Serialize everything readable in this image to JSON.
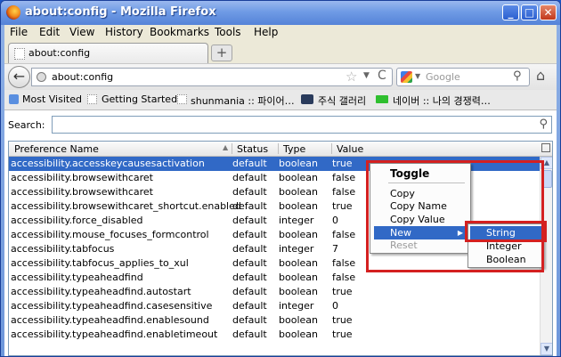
{
  "window": {
    "title": "about:config - Mozilla Firefox",
    "minimize": "_",
    "maximize": "□",
    "close": "✕"
  },
  "menubar": [
    {
      "label": "File"
    },
    {
      "label": "Edit"
    },
    {
      "label": "View"
    },
    {
      "label": "History"
    },
    {
      "label": "Bookmarks"
    },
    {
      "label": "Tools"
    },
    {
      "label": "Help"
    }
  ],
  "tab": {
    "label": "about:config",
    "new_tab": "+"
  },
  "navbar": {
    "url": "about:config",
    "search_placeholder": "Google",
    "back_icon": "←",
    "star_icon": "☆",
    "reload_icon": "C",
    "home_icon": "⌂"
  },
  "bookmarks": [
    {
      "label": "Most Visited"
    },
    {
      "label": "Getting Started"
    },
    {
      "label": "shunmania :: 파이어…"
    },
    {
      "label": "주식 갤러리"
    },
    {
      "label": "네이버 :: 나의 경쟁력…"
    }
  ],
  "search_label": "Search:",
  "columns": {
    "name": "Preference Name",
    "status": "Status",
    "type": "Type",
    "value": "Value"
  },
  "rows": [
    {
      "name": "accessibility.accesskeycausesactivation",
      "status": "default",
      "type": "boolean",
      "value": "true"
    },
    {
      "name": "accessibility.browsewithcaret",
      "status": "default",
      "type": "boolean",
      "value": "false"
    },
    {
      "name": "accessibility.browsewithcaret",
      "status": "default",
      "type": "boolean",
      "value": "false"
    },
    {
      "name": "accessibility.browsewithcaret_shortcut.enabled",
      "status": "default",
      "type": "boolean",
      "value": "true"
    },
    {
      "name": "accessibility.force_disabled",
      "status": "default",
      "type": "integer",
      "value": "0"
    },
    {
      "name": "accessibility.mouse_focuses_formcontrol",
      "status": "default",
      "type": "boolean",
      "value": "false"
    },
    {
      "name": "accessibility.tabfocus",
      "status": "default",
      "type": "integer",
      "value": "7"
    },
    {
      "name": "accessibility.tabfocus_applies_to_xul",
      "status": "default",
      "type": "boolean",
      "value": "false"
    },
    {
      "name": "accessibility.typeaheadfind",
      "status": "default",
      "type": "boolean",
      "value": "false"
    },
    {
      "name": "accessibility.typeaheadfind.autostart",
      "status": "default",
      "type": "boolean",
      "value": "true"
    },
    {
      "name": "accessibility.typeaheadfind.casesensitive",
      "status": "default",
      "type": "integer",
      "value": "0"
    },
    {
      "name": "accessibility.typeaheadfind.enablesound",
      "status": "default",
      "type": "boolean",
      "value": "true"
    },
    {
      "name": "accessibility.typeaheadfind.enabletimeout",
      "status": "default",
      "type": "boolean",
      "value": "true"
    }
  ],
  "context_menu": {
    "toggle": "Toggle",
    "copy": "Copy",
    "copy_name": "Copy Name",
    "copy_value": "Copy Value",
    "new": "New",
    "reset": "Reset"
  },
  "submenu": {
    "string": "String",
    "integer": "Integer",
    "boolean": "Boolean"
  },
  "colors": {
    "selection": "#3169c6",
    "highlight_box": "#d42020"
  }
}
